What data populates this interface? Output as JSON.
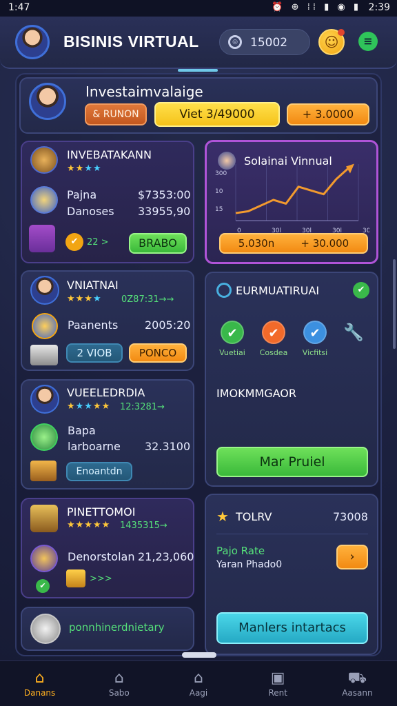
{
  "status_bar": {
    "time_left": "1:47",
    "icons": "⏰ ⊕ ⁞⁞ ▮ ◉ ▮",
    "time_right": "2:39"
  },
  "header": {
    "title": "BISINIS VIRTUAL",
    "coin_value": "15002",
    "emoji": "☺"
  },
  "hero": {
    "title": "Investaimvalaige",
    "btn_left": "& RUNON",
    "btn_mid": "Viet 3/49000",
    "btn_right": "+ 3.0000"
  },
  "card1": {
    "title": "INVEBATAKANN",
    "row1_label": "Pajna",
    "row1_value": "$7353:00",
    "row2_label": "Danoses",
    "row2_value": "33955,90",
    "chip": "22 >",
    "button": "BRABO"
  },
  "chart_card": {
    "title": "Solainai Vinnual",
    "button": "5.030n        + 30.000",
    "chart_data": {
      "type": "line",
      "title": "Solainai Vinnual",
      "y_ticks": [
        "300",
        "10",
        "15"
      ],
      "x_ticks": [
        "0",
        "30l",
        "30l",
        "30l",
        "30l"
      ],
      "x": [
        0,
        1,
        2,
        3,
        4,
        5,
        6,
        7,
        8,
        9
      ],
      "values": [
        1.0,
        1.1,
        1.4,
        1.7,
        1.5,
        2.4,
        2.2,
        2.0,
        2.8,
        3.4
      ]
    }
  },
  "card2": {
    "title": "VNIATNAI",
    "stars_value": "0Z87:31→→",
    "row_label": "Paanents",
    "row_value": "2005:20",
    "btn_left": "2 VIOB",
    "btn_right": "PONCO"
  },
  "card3": {
    "title": "VUEELEDRDIA",
    "stars_value": "12:3281→",
    "row1": "Bapa",
    "row2": "larboarne",
    "row2_value": "32.3100",
    "button": "Enoantdn"
  },
  "card4": {
    "title": "PINETTOMOI",
    "stars_value": "1435315→",
    "row_label": "Denorstolan",
    "row_value": "21,23,060",
    "chip": ">>>"
  },
  "card5": {
    "text": "ponnhinerdnietary"
  },
  "right_mid": {
    "title": "EURMUATIRUAI",
    "icons": [
      {
        "label": "Vuetiai",
        "color": "#39b84a",
        "glyph": "✔"
      },
      {
        "label": "Cosdea",
        "color": "#f26a2a",
        "glyph": "✔"
      },
      {
        "label": "Vicfitsi",
        "color": "#3c90e0",
        "glyph": "✔"
      }
    ],
    "subtitle": "IMOKMMGAOR",
    "button": "Mar Pruiel"
  },
  "right_bottom": {
    "title": "TOLRV",
    "value": "73008",
    "line1": "Pajo Rate",
    "line2": "Yaran Phado0",
    "button": "Manlers intartacs"
  },
  "nav": [
    {
      "label": "Danans",
      "icon": "home-icon",
      "glyph": "⌂"
    },
    {
      "label": "Sabo",
      "icon": "home-outline-icon",
      "glyph": "⌂"
    },
    {
      "label": "Aagi",
      "icon": "house-icon",
      "glyph": "⌂"
    },
    {
      "label": "Rent",
      "icon": "briefcase-icon",
      "glyph": "▣"
    },
    {
      "label": "Aasann",
      "icon": "car-icon",
      "glyph": "⛟"
    }
  ]
}
